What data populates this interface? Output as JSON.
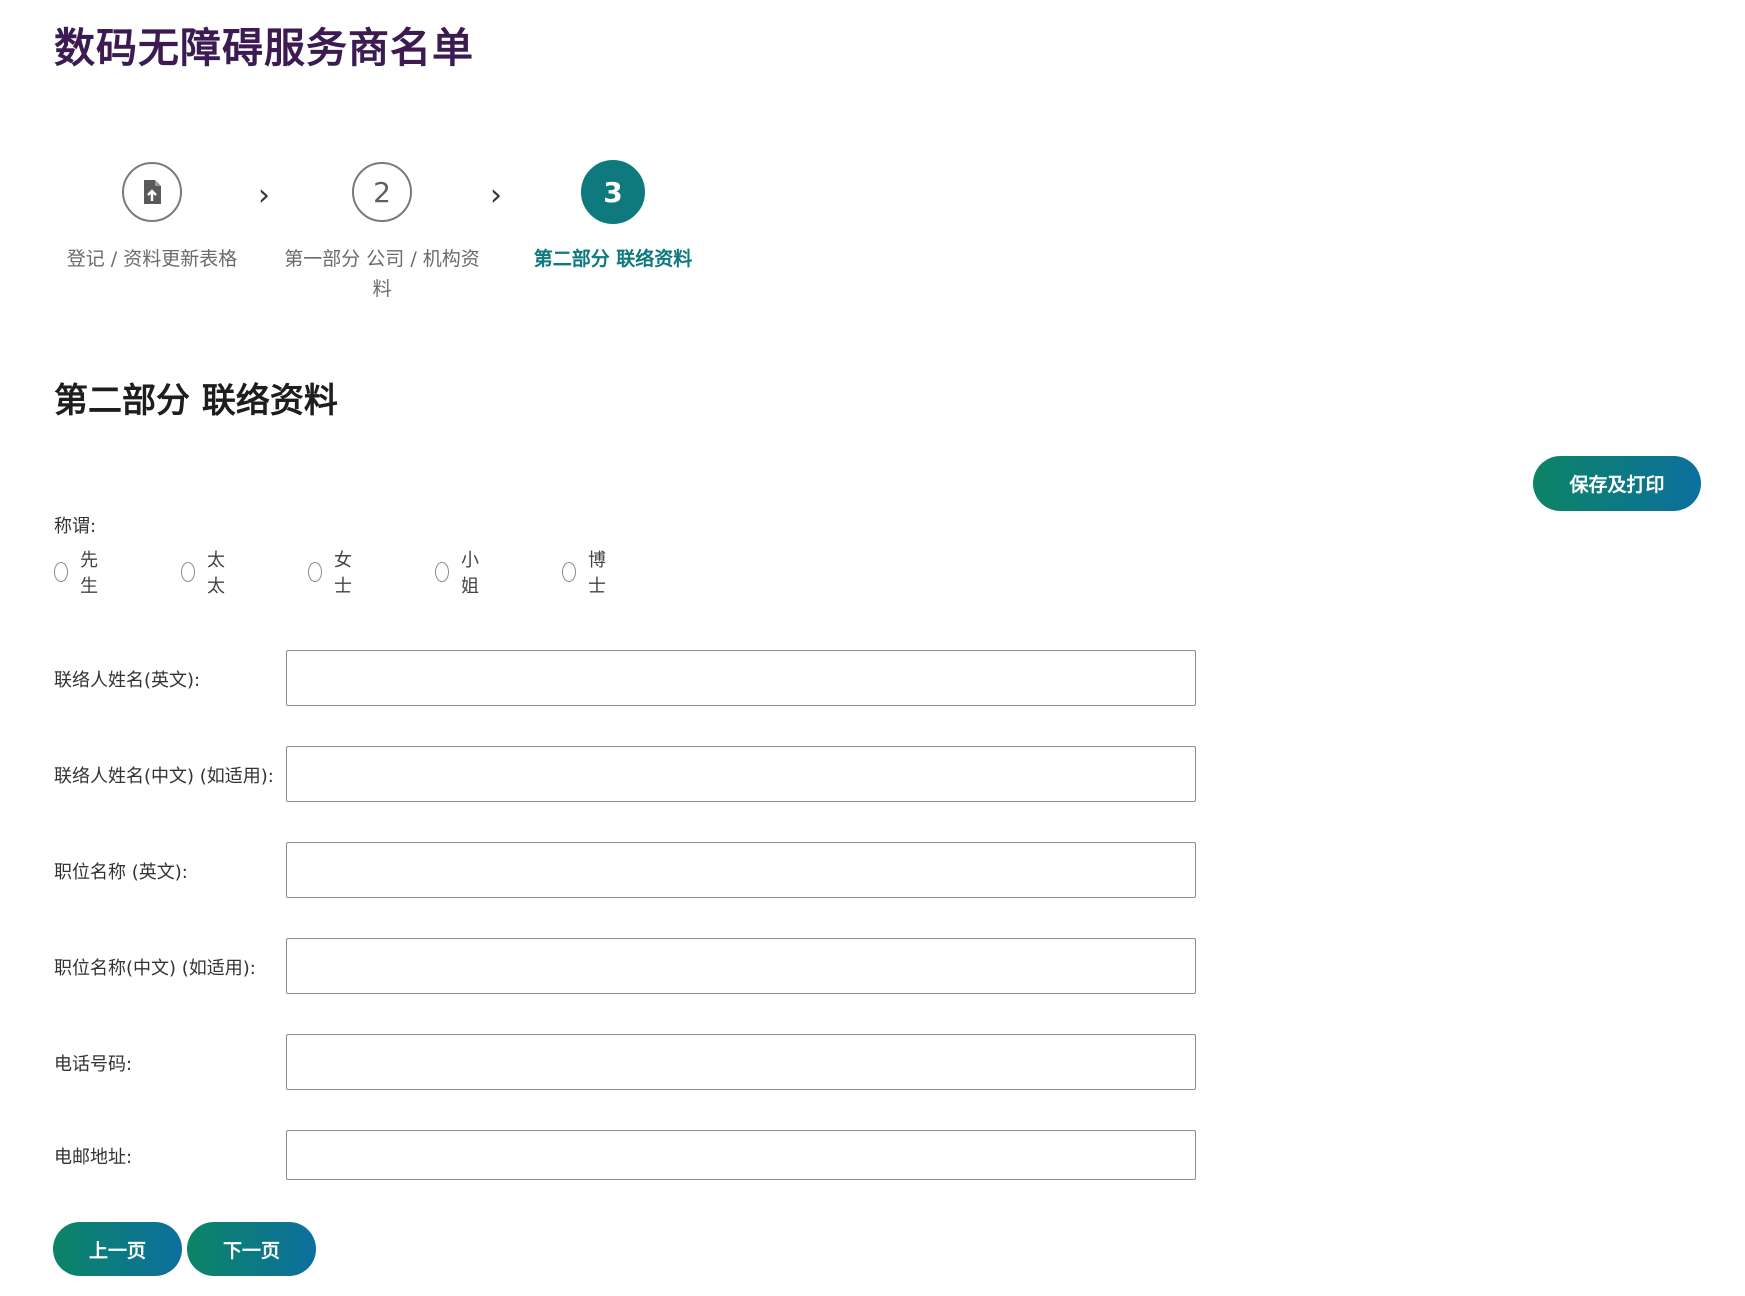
{
  "page": {
    "title": "数码无障碍服务商名单"
  },
  "stepper": {
    "steps": [
      {
        "icon": "document-upload-icon",
        "number": "",
        "label": "登记 / 资料更新表格",
        "state": "completed"
      },
      {
        "icon": "",
        "number": "2",
        "label": "第一部分 公司 / 机构资料",
        "state": "completed"
      },
      {
        "icon": "",
        "number": "3",
        "label": "第二部分 联络资料",
        "state": "active"
      }
    ],
    "separator_icon": "chevron-right-icon",
    "active_color": "#0e7a7d"
  },
  "section": {
    "title": "第二部分 联络资料"
  },
  "actions": {
    "save_print_label": "保存及打印",
    "prev_label": "上一页",
    "next_label": "下一页",
    "gradient_start": "#0c8466",
    "gradient_end": "#0d6f9e"
  },
  "salutation": {
    "label": "称谓:",
    "options": [
      "先生",
      "太太",
      "女士",
      "小姐",
      "博士"
    ],
    "selected": null
  },
  "fields": [
    {
      "label": "联络人姓名(英文):",
      "value": ""
    },
    {
      "label": "联络人姓名(中文) (如适用):",
      "value": ""
    },
    {
      "label": "职位名称 (英文):",
      "value": ""
    },
    {
      "label": "职位名称(中文) (如适用):",
      "value": ""
    },
    {
      "label": "电话号码:",
      "value": ""
    },
    {
      "label": "电邮地址:",
      "value": ""
    }
  ]
}
